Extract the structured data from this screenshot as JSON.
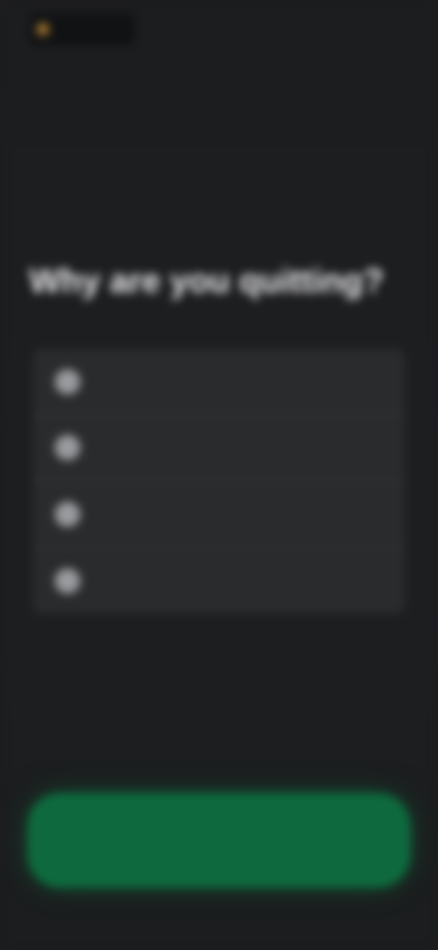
{
  "header": {
    "logo_text": "",
    "top_link_label": ""
  },
  "question": {
    "title": "Why are you quitting?"
  },
  "options": [
    {
      "label": "",
      "icon": "radio-icon"
    },
    {
      "label": "",
      "icon": "radio-icon"
    },
    {
      "label": "",
      "icon": "radio-icon"
    },
    {
      "label": "",
      "icon": "radio-icon"
    }
  ],
  "footer": {
    "secondary_link_label": "",
    "primary_button_label": ""
  },
  "colors": {
    "background": "#1c1d1f",
    "card": "#2a2b2d",
    "accent_green": "#0e6a3e",
    "logo_gold": "#a3782f"
  }
}
